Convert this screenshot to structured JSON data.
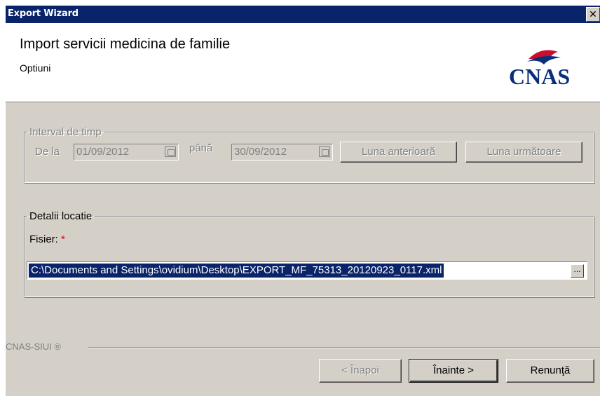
{
  "window": {
    "title": "Export Wizard",
    "close_label": "x"
  },
  "header": {
    "title": "Import servicii medicina de familie",
    "subtitle": "Optiuni",
    "logo_text": "CNAS"
  },
  "interval": {
    "legend": "Interval de timp",
    "from_label": "De la",
    "from_value": "01/09/2012",
    "to_label": "până",
    "to_value": "30/09/2012",
    "prev_month_label": "Luna anterioară",
    "next_month_label": "Luna următoare"
  },
  "location": {
    "legend": "Detalii locatie",
    "file_label": "Fisier:",
    "required_mark": "*",
    "file_value": "C:\\Documents and Settings\\ovidium\\Desktop\\EXPORT_MF_75313_20120923_0117.xml",
    "browse_label": "..."
  },
  "footer": {
    "brand": "CNAS-SIUI ®",
    "back_label": "< Înapoi",
    "next_label": "Înainte >",
    "cancel_label": "Renunţă"
  },
  "colors": {
    "titlebar": "#0a246a",
    "dialog": "#d4d0c8",
    "logo_red": "#c8102e",
    "logo_blue": "#0a2f7a"
  }
}
